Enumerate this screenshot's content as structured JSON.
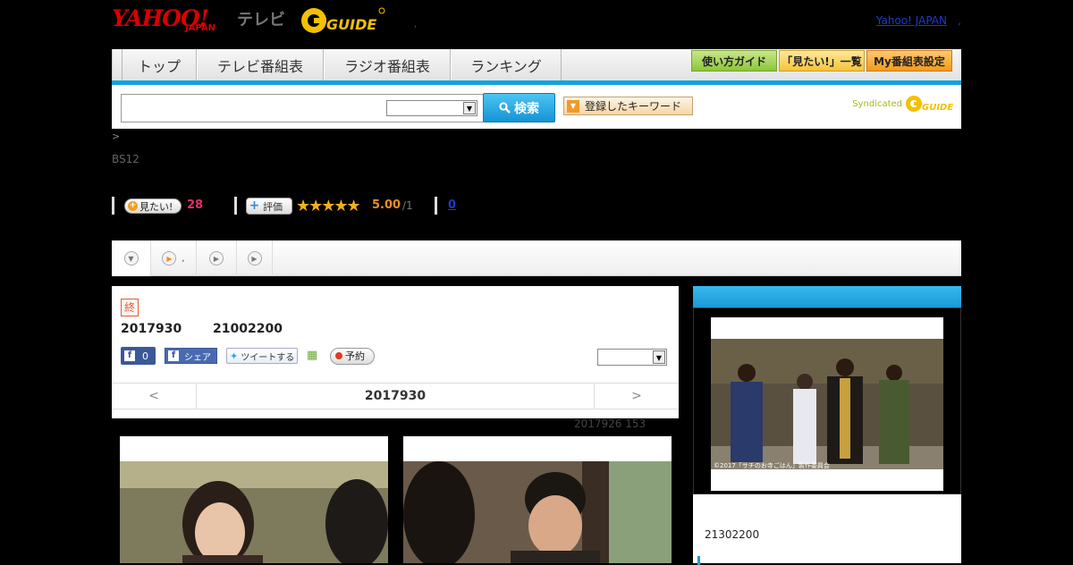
{
  "header": {
    "logo_yahoo": "YAHOO!",
    "logo_japan": "JAPAN",
    "logo_tv": "テレビ",
    "logo_gguide": "G GUIDE",
    "dot": ",",
    "yahoo_japan_link": "Yahoo! JAPAN",
    "trailing": ","
  },
  "nav": {
    "tabs": [
      "トップ",
      "テレビ番組表",
      "ラジオ番組表",
      "ランキング"
    ],
    "buttons": {
      "guide": "使い方ガイド",
      "mitai_list": "「見たい!」一覧",
      "my_schedule": "My番組表設定"
    },
    "accent": "#12a1e0"
  },
  "search": {
    "input_value": "",
    "select_value": "",
    "button_label": "検索",
    "keyword_button": "登録したキーワード",
    "syndicated": "Syndicated",
    "syndicated_logo": "G GUIDE"
  },
  "info": {
    "breadcrumb": ">",
    "channel": "BS12",
    "mitai_label": "見たい!",
    "mitai_count": "28",
    "rate_label": "評価",
    "stars": "★★★★★",
    "rating": 5.0,
    "score": "5.00",
    "score_den": "/1",
    "review_count": "0"
  },
  "tabs": [
    {
      "icon": "▼",
      "label": ""
    },
    {
      "icon": "▶",
      "label": ","
    },
    {
      "icon": "▶",
      "label": ""
    },
    {
      "icon": "▶",
      "label": ""
    }
  ],
  "program": {
    "status_badge": "終",
    "date": "2017930",
    "time": "21002200",
    "fb_like_count": "0",
    "fb_share": "シェア",
    "tweet": "ツイートする",
    "record": "予約",
    "select_value": "",
    "nav": {
      "prev": "<",
      "date": "2017930",
      "next": ">"
    },
    "update_note": "2017926  153"
  },
  "side": {
    "copyright": "©2017「サチのお寺ごはん」製作委員会",
    "time": "21302200"
  }
}
